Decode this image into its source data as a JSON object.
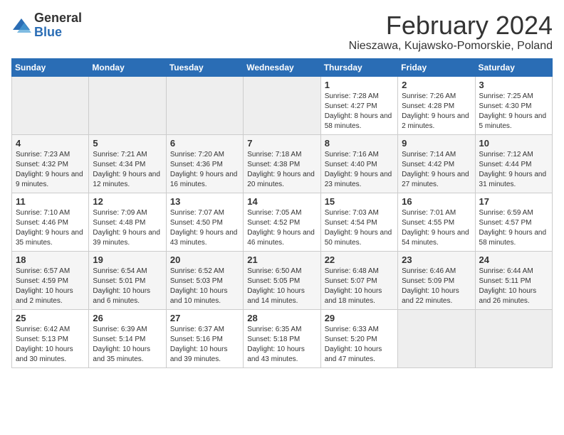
{
  "logo": {
    "general": "General",
    "blue": "Blue"
  },
  "header": {
    "title": "February 2024",
    "subtitle": "Nieszawa, Kujawsko-Pomorskie, Poland"
  },
  "days": [
    "Sunday",
    "Monday",
    "Tuesday",
    "Wednesday",
    "Thursday",
    "Friday",
    "Saturday"
  ],
  "weeks": [
    [
      {
        "day": "",
        "sunrise": "",
        "sunset": "",
        "daylight": "",
        "empty": true
      },
      {
        "day": "",
        "sunrise": "",
        "sunset": "",
        "daylight": "",
        "empty": true
      },
      {
        "day": "",
        "sunrise": "",
        "sunset": "",
        "daylight": "",
        "empty": true
      },
      {
        "day": "",
        "sunrise": "",
        "sunset": "",
        "daylight": "",
        "empty": true
      },
      {
        "day": "1",
        "sunrise": "Sunrise: 7:28 AM",
        "sunset": "Sunset: 4:27 PM",
        "daylight": "Daylight: 8 hours and 58 minutes."
      },
      {
        "day": "2",
        "sunrise": "Sunrise: 7:26 AM",
        "sunset": "Sunset: 4:28 PM",
        "daylight": "Daylight: 9 hours and 2 minutes."
      },
      {
        "day": "3",
        "sunrise": "Sunrise: 7:25 AM",
        "sunset": "Sunset: 4:30 PM",
        "daylight": "Daylight: 9 hours and 5 minutes."
      }
    ],
    [
      {
        "day": "4",
        "sunrise": "Sunrise: 7:23 AM",
        "sunset": "Sunset: 4:32 PM",
        "daylight": "Daylight: 9 hours and 9 minutes."
      },
      {
        "day": "5",
        "sunrise": "Sunrise: 7:21 AM",
        "sunset": "Sunset: 4:34 PM",
        "daylight": "Daylight: 9 hours and 12 minutes."
      },
      {
        "day": "6",
        "sunrise": "Sunrise: 7:20 AM",
        "sunset": "Sunset: 4:36 PM",
        "daylight": "Daylight: 9 hours and 16 minutes."
      },
      {
        "day": "7",
        "sunrise": "Sunrise: 7:18 AM",
        "sunset": "Sunset: 4:38 PM",
        "daylight": "Daylight: 9 hours and 20 minutes."
      },
      {
        "day": "8",
        "sunrise": "Sunrise: 7:16 AM",
        "sunset": "Sunset: 4:40 PM",
        "daylight": "Daylight: 9 hours and 23 minutes."
      },
      {
        "day": "9",
        "sunrise": "Sunrise: 7:14 AM",
        "sunset": "Sunset: 4:42 PM",
        "daylight": "Daylight: 9 hours and 27 minutes."
      },
      {
        "day": "10",
        "sunrise": "Sunrise: 7:12 AM",
        "sunset": "Sunset: 4:44 PM",
        "daylight": "Daylight: 9 hours and 31 minutes."
      }
    ],
    [
      {
        "day": "11",
        "sunrise": "Sunrise: 7:10 AM",
        "sunset": "Sunset: 4:46 PM",
        "daylight": "Daylight: 9 hours and 35 minutes."
      },
      {
        "day": "12",
        "sunrise": "Sunrise: 7:09 AM",
        "sunset": "Sunset: 4:48 PM",
        "daylight": "Daylight: 9 hours and 39 minutes."
      },
      {
        "day": "13",
        "sunrise": "Sunrise: 7:07 AM",
        "sunset": "Sunset: 4:50 PM",
        "daylight": "Daylight: 9 hours and 43 minutes."
      },
      {
        "day": "14",
        "sunrise": "Sunrise: 7:05 AM",
        "sunset": "Sunset: 4:52 PM",
        "daylight": "Daylight: 9 hours and 46 minutes."
      },
      {
        "day": "15",
        "sunrise": "Sunrise: 7:03 AM",
        "sunset": "Sunset: 4:54 PM",
        "daylight": "Daylight: 9 hours and 50 minutes."
      },
      {
        "day": "16",
        "sunrise": "Sunrise: 7:01 AM",
        "sunset": "Sunset: 4:55 PM",
        "daylight": "Daylight: 9 hours and 54 minutes."
      },
      {
        "day": "17",
        "sunrise": "Sunrise: 6:59 AM",
        "sunset": "Sunset: 4:57 PM",
        "daylight": "Daylight: 9 hours and 58 minutes."
      }
    ],
    [
      {
        "day": "18",
        "sunrise": "Sunrise: 6:57 AM",
        "sunset": "Sunset: 4:59 PM",
        "daylight": "Daylight: 10 hours and 2 minutes."
      },
      {
        "day": "19",
        "sunrise": "Sunrise: 6:54 AM",
        "sunset": "Sunset: 5:01 PM",
        "daylight": "Daylight: 10 hours and 6 minutes."
      },
      {
        "day": "20",
        "sunrise": "Sunrise: 6:52 AM",
        "sunset": "Sunset: 5:03 PM",
        "daylight": "Daylight: 10 hours and 10 minutes."
      },
      {
        "day": "21",
        "sunrise": "Sunrise: 6:50 AM",
        "sunset": "Sunset: 5:05 PM",
        "daylight": "Daylight: 10 hours and 14 minutes."
      },
      {
        "day": "22",
        "sunrise": "Sunrise: 6:48 AM",
        "sunset": "Sunset: 5:07 PM",
        "daylight": "Daylight: 10 hours and 18 minutes."
      },
      {
        "day": "23",
        "sunrise": "Sunrise: 6:46 AM",
        "sunset": "Sunset: 5:09 PM",
        "daylight": "Daylight: 10 hours and 22 minutes."
      },
      {
        "day": "24",
        "sunrise": "Sunrise: 6:44 AM",
        "sunset": "Sunset: 5:11 PM",
        "daylight": "Daylight: 10 hours and 26 minutes."
      }
    ],
    [
      {
        "day": "25",
        "sunrise": "Sunrise: 6:42 AM",
        "sunset": "Sunset: 5:13 PM",
        "daylight": "Daylight: 10 hours and 30 minutes."
      },
      {
        "day": "26",
        "sunrise": "Sunrise: 6:39 AM",
        "sunset": "Sunset: 5:14 PM",
        "daylight": "Daylight: 10 hours and 35 minutes."
      },
      {
        "day": "27",
        "sunrise": "Sunrise: 6:37 AM",
        "sunset": "Sunset: 5:16 PM",
        "daylight": "Daylight: 10 hours and 39 minutes."
      },
      {
        "day": "28",
        "sunrise": "Sunrise: 6:35 AM",
        "sunset": "Sunset: 5:18 PM",
        "daylight": "Daylight: 10 hours and 43 minutes."
      },
      {
        "day": "29",
        "sunrise": "Sunrise: 6:33 AM",
        "sunset": "Sunset: 5:20 PM",
        "daylight": "Daylight: 10 hours and 47 minutes."
      },
      {
        "day": "",
        "sunrise": "",
        "sunset": "",
        "daylight": "",
        "empty": true
      },
      {
        "day": "",
        "sunrise": "",
        "sunset": "",
        "daylight": "",
        "empty": true
      }
    ]
  ]
}
